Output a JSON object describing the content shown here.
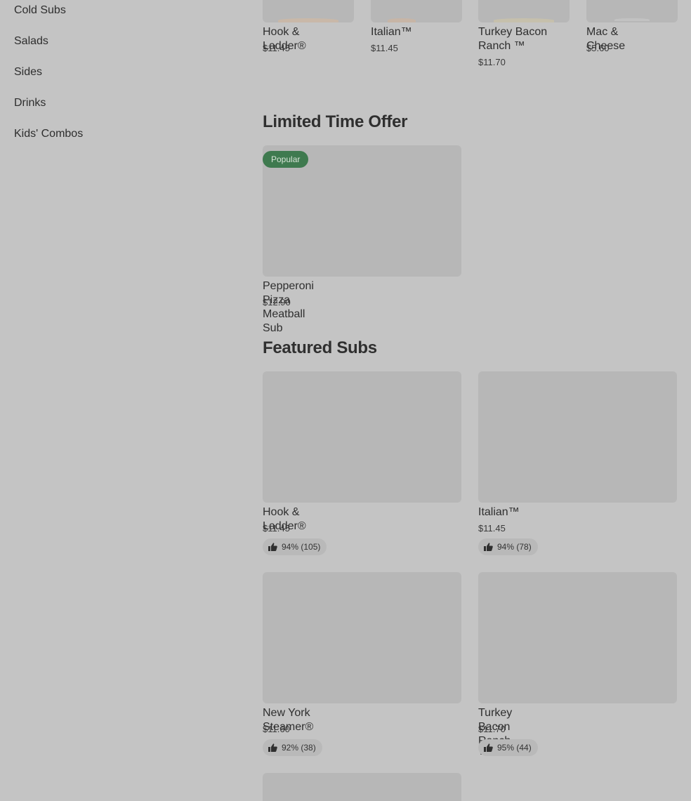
{
  "sidebar": {
    "items": [
      {
        "label": "Cold Subs"
      },
      {
        "label": "Salads"
      },
      {
        "label": "Sides"
      },
      {
        "label": "Drinks"
      },
      {
        "label": "Kids' Combos"
      }
    ]
  },
  "top_row": [
    {
      "name": "Hook & Ladder®",
      "price": "$11.45"
    },
    {
      "name": "Italian™",
      "price": "$11.45"
    },
    {
      "name": "Turkey Bacon Ranch ™",
      "price": "$11.70"
    },
    {
      "name": "Mac & Cheese",
      "price": "$5.60"
    }
  ],
  "limited": {
    "title": "Limited Time Offer",
    "item": {
      "badge": "Popular",
      "name": "Pepperoni Pizza Meatball Sub",
      "price": "$12.90"
    }
  },
  "featured": {
    "title": "Featured Subs",
    "items": [
      {
        "name": "Hook & Ladder®",
        "price": "$11.45",
        "rating": "94% (105)"
      },
      {
        "name": "Italian™",
        "price": "$11.45",
        "rating": "94% (78)"
      },
      {
        "name": "New York Steamer®",
        "price": "$11.60",
        "rating": "92% (38)"
      },
      {
        "name": "Turkey Bacon Ranch ™",
        "price": "$11.70",
        "rating": "95% (44)"
      }
    ]
  }
}
